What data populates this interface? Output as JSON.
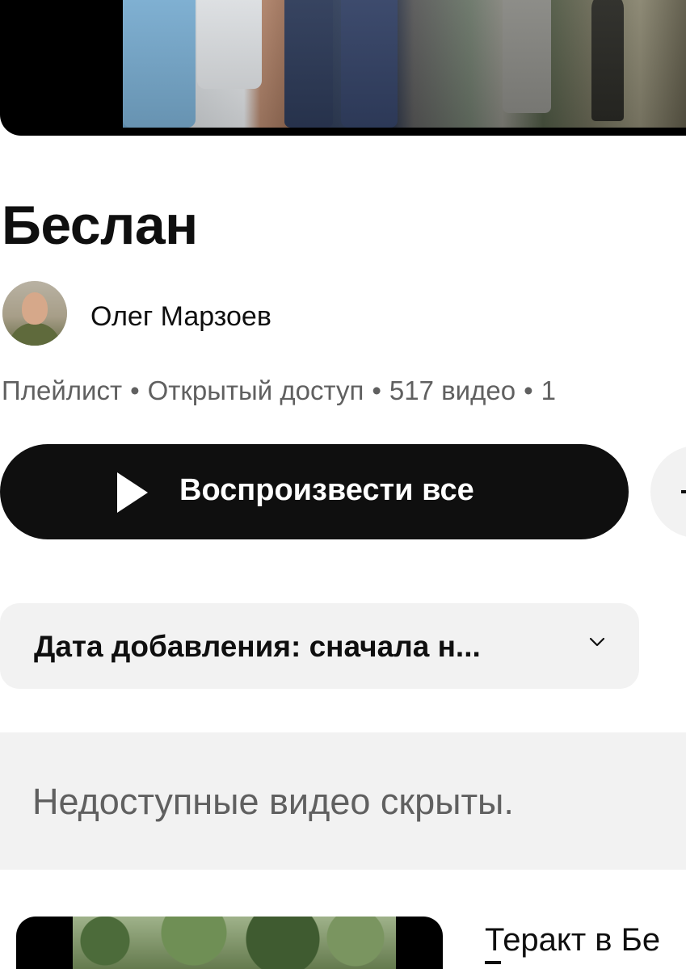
{
  "playlist": {
    "title": "Беслан",
    "channel_name": "Олег Марзоев",
    "meta": {
      "type": "Плейлист",
      "access": "Открытый доступ",
      "video_count": "517 видео",
      "extra": "1"
    },
    "play_all_label": "Воспроизвести все",
    "sort_label": "Дата добавления: сначала н...",
    "hidden_notice": "Недоступные видео скрыты."
  },
  "videos": [
    {
      "title": "Теракт в Бе"
    }
  ],
  "icons": {
    "play": "play-icon",
    "chevron": "chevron-down-icon",
    "second_button": "shuffle-icon"
  },
  "colors": {
    "primary_button": "#0f0f0f",
    "chip_background": "#f2f2f2",
    "secondary_text": "#606060"
  }
}
